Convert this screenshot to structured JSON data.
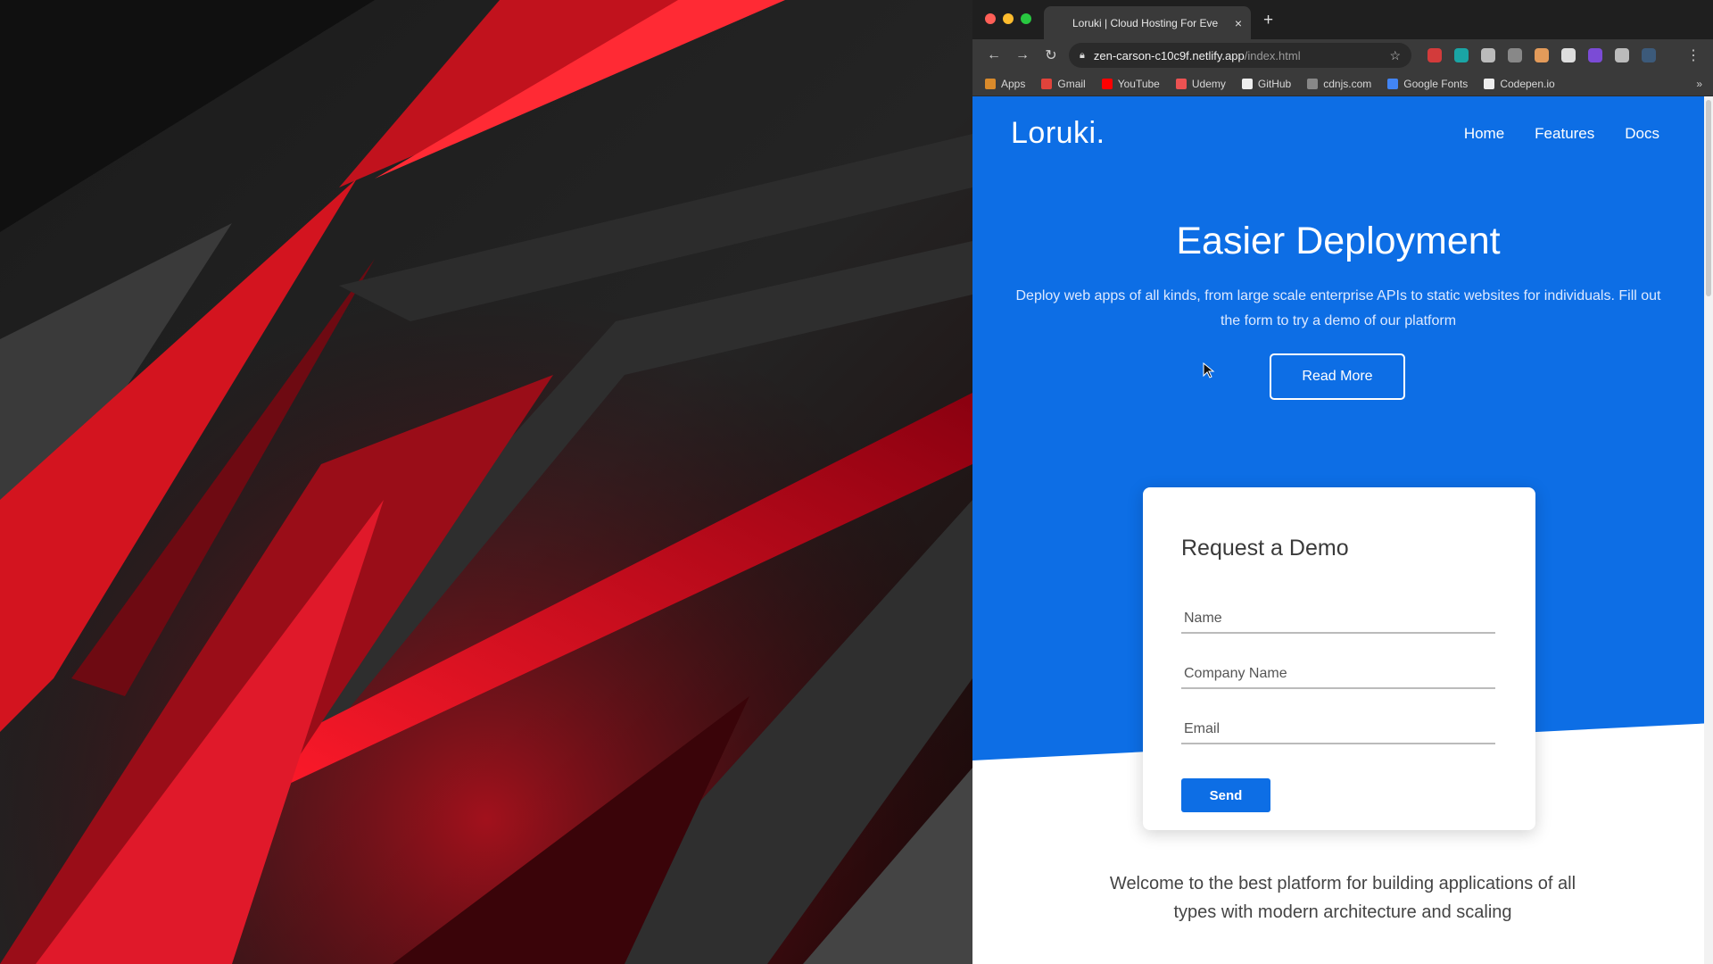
{
  "browser": {
    "tab_title": "Loruki | Cloud Hosting For Eve",
    "tab_close": "×",
    "new_tab": "+",
    "url_host": "zen-carson-c10c9f.netlify.app",
    "url_path": "/index.html",
    "bookmarks": [
      {
        "label": "Apps",
        "color": "#d98a2b"
      },
      {
        "label": "Gmail",
        "color": "#e0433b"
      },
      {
        "label": "YouTube",
        "color": "#ff0000"
      },
      {
        "label": "Udemy",
        "color": "#ec5252"
      },
      {
        "label": "GitHub",
        "color": "#eeeeee"
      },
      {
        "label": "cdnjs.com",
        "color": "#888888"
      },
      {
        "label": "Google Fonts",
        "color": "#4285f4"
      },
      {
        "label": "Codepen.io",
        "color": "#eeeeee"
      }
    ],
    "bookmarks_more": "»",
    "extension_colors": [
      "#d33b3b",
      "#1aa5a5",
      "#bbbbbb",
      "#888888",
      "#e39b5a",
      "#dddddd",
      "#7b4bd6",
      "#bbbbbb",
      "#3c5a7a"
    ]
  },
  "site": {
    "logo": "Loruki.",
    "nav": [
      "Home",
      "Features",
      "Docs"
    ],
    "hero_title": "Easier Deployment",
    "hero_text": "Deploy web apps of all kinds, from large scale enterprise APIs to static websites for individuals. Fill out the form to try a demo of our platform",
    "read_more": "Read More",
    "form": {
      "title": "Request a Demo",
      "name_placeholder": "Name",
      "company_placeholder": "Company Name",
      "email_placeholder": "Email",
      "send": "Send"
    },
    "welcome": "Welcome to the best platform for building applications of all types with modern architecture and scaling"
  },
  "colors": {
    "brand_blue": "#0d6ee5",
    "accent_red": "#e01522"
  }
}
